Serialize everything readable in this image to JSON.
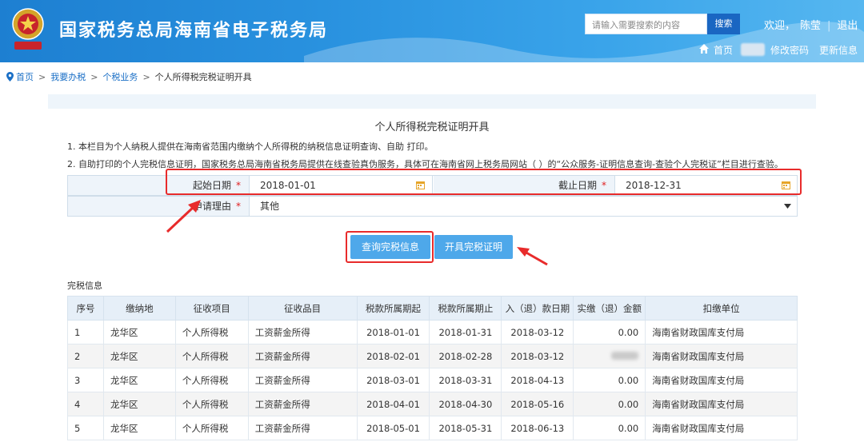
{
  "header": {
    "site_title": "国家税务总局海南省电子税务局",
    "search_placeholder": "请输入需要搜索的内容",
    "search_button": "搜索",
    "welcome": "欢迎，",
    "user_name": "陈莹",
    "logout": "退出",
    "home": "首页",
    "change_password": "修改密码",
    "update_info": "更新信息",
    "brand_color": "#2a93e0"
  },
  "breadcrumb": {
    "home": "首页",
    "my_office": "我要办税",
    "iit_business": "个税业务",
    "current": "个人所得税完税证明开具"
  },
  "panel": {
    "title": "个人所得税完税证明开具",
    "note1": "1. 本栏目为个人纳税人提供在海南省范围内缴纳个人所得税的纳税信息证明查询、自助 打印。",
    "note2": "2. 自助打印的个人完税信息证明，国家税务总局海南省税务局提供在线查验真伪服务，具体可在海南省网上税务局网站（ ）的“公众服务-证明信息查询-查验个人完税证”栏目进行查验。"
  },
  "form": {
    "start_date_label": "起始日期",
    "start_date_value": "2018-01-01",
    "end_date_label": "截止日期",
    "end_date_value": "2018-12-31",
    "reason_label": "申请理由",
    "reason_value": "其他",
    "required_mark": "*"
  },
  "buttons": {
    "query": "查询完税信息",
    "issue": "开具完税证明"
  },
  "info": {
    "label": "完税信息",
    "columns": [
      "序号",
      "缴纳地",
      "征收项目",
      "征收品目",
      "税款所属期起",
      "税款所属期止",
      "入（退）款日期",
      "实缴（退）金额",
      "扣缴单位"
    ],
    "rows": [
      [
        "1",
        "龙华区",
        "个人所得税",
        "工资薪金所得",
        "2018-01-01",
        "2018-01-31",
        "2018-03-12",
        "0.00",
        "海南省财政国库支付局"
      ],
      [
        "2",
        "龙华区",
        "个人所得税",
        "工资薪金所得",
        "2018-02-01",
        "2018-02-28",
        "2018-03-12",
        "",
        "海南省财政国库支付局"
      ],
      [
        "3",
        "龙华区",
        "个人所得税",
        "工资薪金所得",
        "2018-03-01",
        "2018-03-31",
        "2018-04-13",
        "0.00",
        "海南省财政国库支付局"
      ],
      [
        "4",
        "龙华区",
        "个人所得税",
        "工资薪金所得",
        "2018-04-01",
        "2018-04-30",
        "2018-05-16",
        "0.00",
        "海南省财政国库支付局"
      ],
      [
        "5",
        "龙华区",
        "个人所得税",
        "工资薪金所得",
        "2018-05-01",
        "2018-05-31",
        "2018-06-13",
        "0.00",
        "海南省财政国库支付局"
      ]
    ]
  }
}
